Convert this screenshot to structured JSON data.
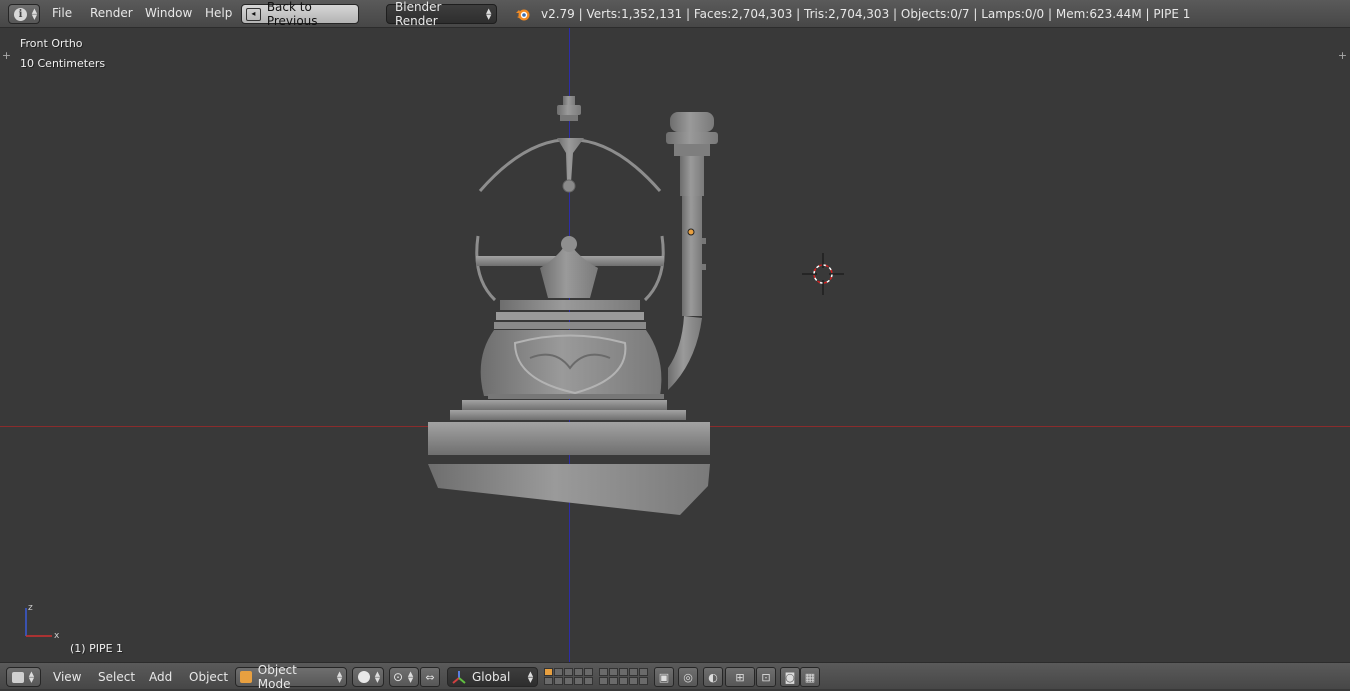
{
  "header": {
    "menus": [
      "File",
      "Render",
      "Window",
      "Help"
    ],
    "back_button": "Back to Previous",
    "render_engine": "Blender Render",
    "stats": "v2.79 | Verts:1,352,131 | Faces:2,704,303 | Tris:2,704,303 | Objects:0/7 | Lamps:0/0 | Mem:623.44M | PIPE 1"
  },
  "viewport": {
    "view_name": "Front Ortho",
    "grid_scale": "10 Centimeters",
    "object_label": "(1) PIPE 1",
    "axis_labels": {
      "z": "z",
      "x": "x"
    }
  },
  "footer": {
    "menus": [
      "View",
      "Select",
      "Add",
      "Object"
    ],
    "mode": "Object Mode",
    "transform_orientation": "Global"
  },
  "colors": {
    "header_bg": "#4b4b4b",
    "viewport_bg": "#393939",
    "z_axis": "#2d2da8",
    "x_axis": "#8a2c2c",
    "model": "#8c8c8c"
  }
}
